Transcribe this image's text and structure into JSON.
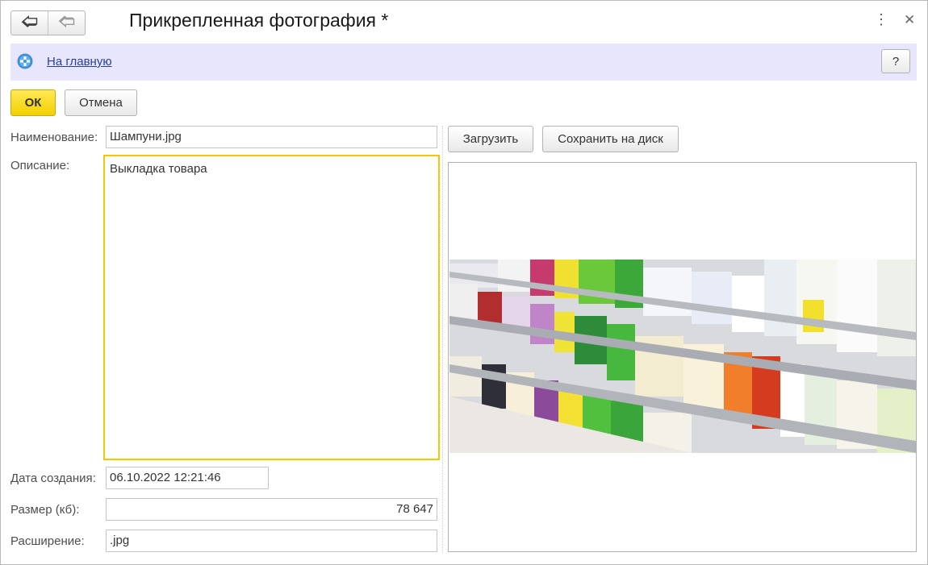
{
  "window": {
    "title": "Прикрепленная фотография *",
    "back_icon": "arrow-left-icon",
    "forward_icon": "arrow-right-icon",
    "menu_icon": "more-vert-icon",
    "close_icon": "close-icon"
  },
  "home_bar": {
    "link": "На главную",
    "icon": "home-icon",
    "help_label": "?"
  },
  "toolbar": {
    "ok_label": "ОК",
    "cancel_label": "Отмена"
  },
  "form": {
    "name_label": "Наименование:",
    "name_value": "Шампуни.jpg",
    "description_label": "Описание:",
    "description_value": "Выкладка товара",
    "date_label": "Дата создания:",
    "date_value": "06.10.2022 12:21:46",
    "size_label": "Размер (кб):",
    "size_value": "78 647",
    "extension_label": "Расширение:",
    "extension_value": ".jpg"
  },
  "photo_panel": {
    "load_label": "Загрузить",
    "save_label": "Сохранить на диск"
  },
  "colors": {
    "accent_yellow": "#f2cf00",
    "home_bar_bg": "#e7e6fd",
    "link_blue": "#27409f"
  }
}
